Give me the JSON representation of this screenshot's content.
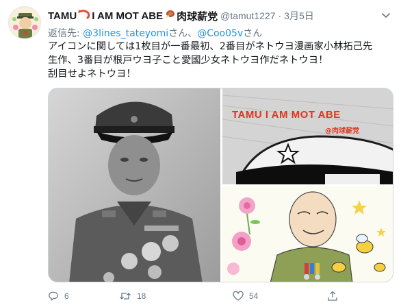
{
  "tweet": {
    "display_name": "TAMU",
    "display_name_mid": " I AM MOT ABE ",
    "display_name_end": "肉球薪党",
    "handle": "@tamut1227",
    "separator": "·",
    "date": "3月5日",
    "reply_prefix": "返信先: ",
    "reply_to_1": "@3lines_tateyomi",
    "reply_mid": "さん、",
    "reply_to_2": "@Coo05v",
    "reply_suffix": "さん",
    "text_lines": [
      "アイコンに関しては1枚目が一番最初、2番目がネトウヨ漫画家小林拓己先",
      "生作、3番目が根戸ウヨ子こと愛國少女ネトウヨ作だネトウヨ！",
      "刮目せよネトウヨ！"
    ]
  },
  "media": {
    "img2_title": "TAMU  I AM MOT ABE",
    "img2_sub": "@肉球薪党"
  },
  "actions": {
    "reply_count": "6",
    "retweet_count": "18",
    "like_count": "54"
  },
  "icons": [
    "avatar",
    "shrimp-emoji-icon",
    "meat-emoji-icon",
    "caret-down-icon",
    "reply-icon",
    "retweet-icon",
    "like-icon",
    "share-icon"
  ],
  "colors": {
    "link": "#1b95e0",
    "secondary": "#657786",
    "text": "#14171a",
    "border": "#ccd6dd",
    "accent_red": "#e0341f"
  }
}
